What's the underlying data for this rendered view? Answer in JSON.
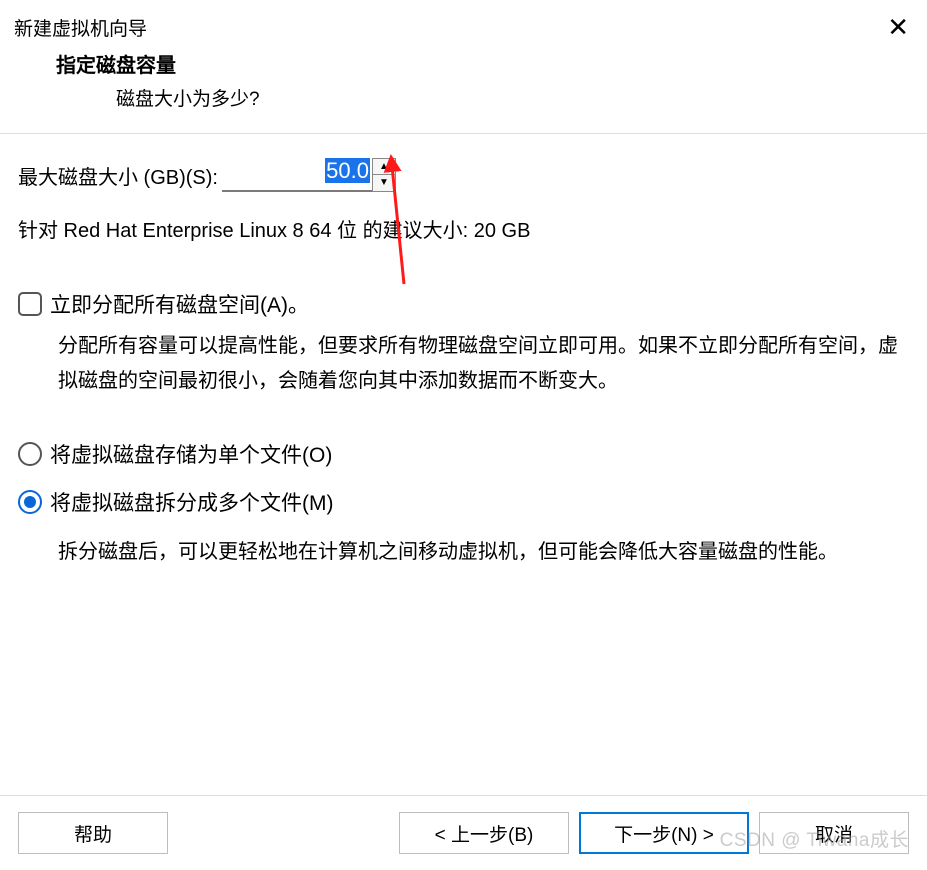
{
  "titlebar": {
    "title": "新建虚拟机向导"
  },
  "header": {
    "heading": "指定磁盘容量",
    "subheading": "磁盘大小为多少?"
  },
  "size": {
    "label": "最大磁盘大小 (GB)(S):",
    "value": "50.0"
  },
  "recommend": "针对 Red Hat Enterprise Linux 8 64 位 的建议大小: 20 GB",
  "allocate": {
    "label": "立即分配所有磁盘空间(A)。",
    "checked": false,
    "desc": "分配所有容量可以提高性能，但要求所有物理磁盘空间立即可用。如果不立即分配所有空间，虚拟磁盘的空间最初很小，会随着您向其中添加数据而不断变大。"
  },
  "store": {
    "single_label": "将虚拟磁盘存储为单个文件(O)",
    "multi_label": "将虚拟磁盘拆分成多个文件(M)",
    "selected": "multi",
    "multi_desc": "拆分磁盘后，可以更轻松地在计算机之间移动虚拟机，但可能会降低大容量磁盘的性能。"
  },
  "buttons": {
    "help": "帮助",
    "back": "< 上一步(B)",
    "next": "下一步(N) >",
    "cancel": "取消"
  },
  "watermark": "CSDN @ Tiwana成长"
}
